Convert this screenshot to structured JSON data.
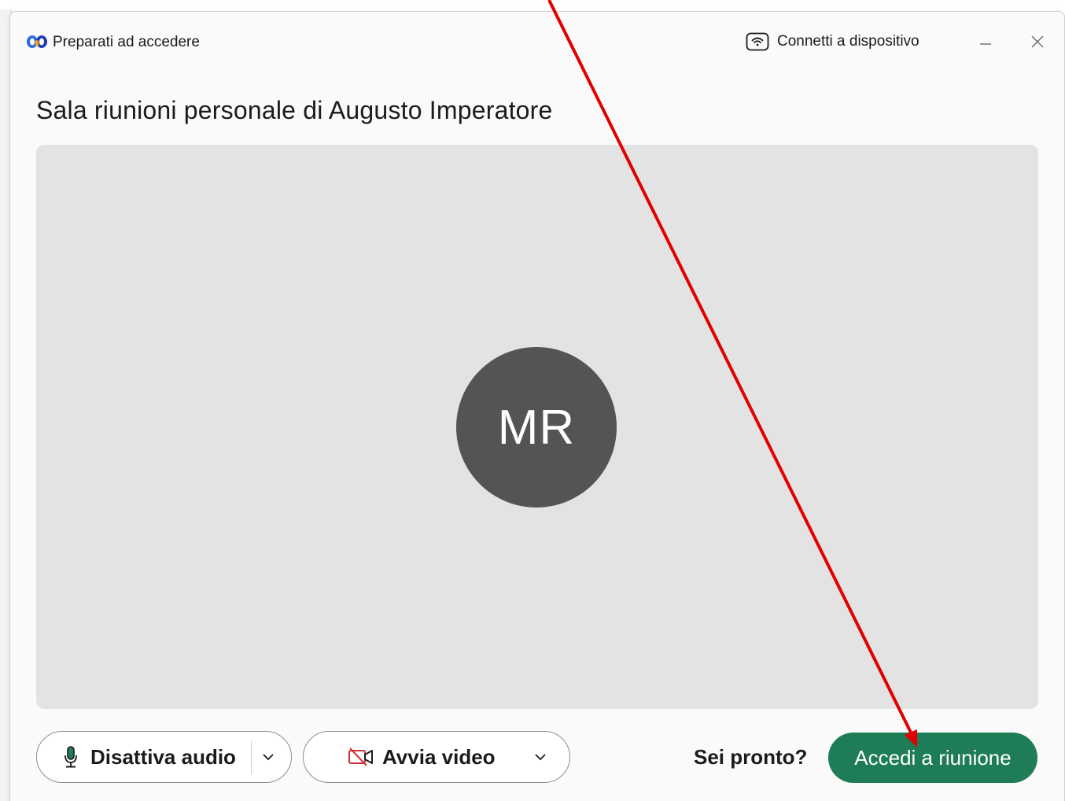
{
  "window": {
    "title": "Preparati ad accedere",
    "connect_label": "Connetti a dispositivo"
  },
  "meeting": {
    "title": "Sala riunioni personale di Augusto Imperatore",
    "avatar_initials": "MR"
  },
  "controls": {
    "audio_label": "Disattiva audio",
    "video_label": "Avvia video",
    "ready_text": "Sei pronto?",
    "join_label": "Accedi a riunione"
  },
  "icons": {
    "app_logo": "webex-logo-icon",
    "connect": "wireless-device-icon",
    "minimize": "minimize-icon",
    "close": "close-icon",
    "microphone": "microphone-icon",
    "video_off": "video-off-icon",
    "chevron": "chevron-down-icon"
  },
  "colors": {
    "join_button": "#1e7d57",
    "avatar_bg": "#545454",
    "preview_bg": "#e3e3e3",
    "video_off_icon": "#d0303a",
    "microphone_icon": "#1e7d57",
    "annotation_arrow": "#e00000"
  }
}
